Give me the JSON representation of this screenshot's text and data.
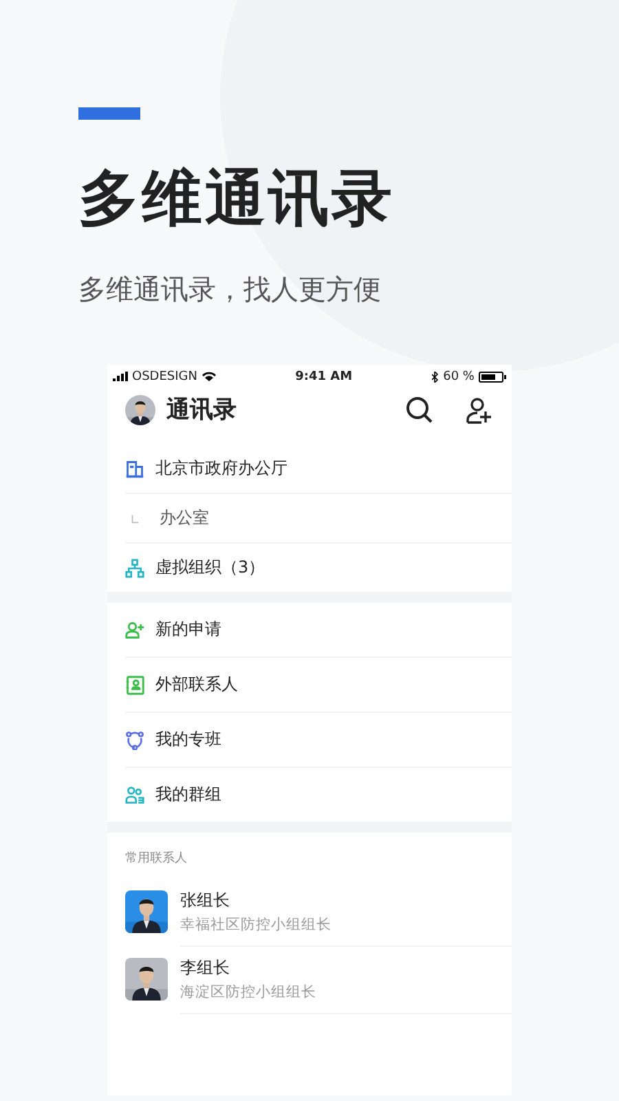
{
  "hero": {
    "title": "多维通讯录",
    "subtitle": "多维通讯录，找人更方便"
  },
  "status_bar": {
    "carrier": "OSDESIGN",
    "time": "9:41 AM",
    "battery": "60 %"
  },
  "header": {
    "title": "通讯录"
  },
  "org_items": [
    {
      "kind": "building",
      "label": "北京市政府办公厅"
    },
    {
      "kind": "sub",
      "label": "办公室"
    },
    {
      "kind": "org",
      "label": "虚拟组织（3）"
    }
  ],
  "menu_items": [
    {
      "kind": "add-person",
      "label": "新的申请"
    },
    {
      "kind": "contact-book",
      "label": "外部联系人"
    },
    {
      "kind": "circle",
      "label": "我的专班"
    },
    {
      "kind": "group",
      "label": "我的群组"
    }
  ],
  "frequent": {
    "title": "常用联系人",
    "contacts": [
      {
        "name": "张组长",
        "role": "幸福社区防控小组组长",
        "kind": "picture"
      },
      {
        "name": "李组长",
        "role": "海淀区防控小组组长",
        "kind": "picture"
      }
    ]
  }
}
